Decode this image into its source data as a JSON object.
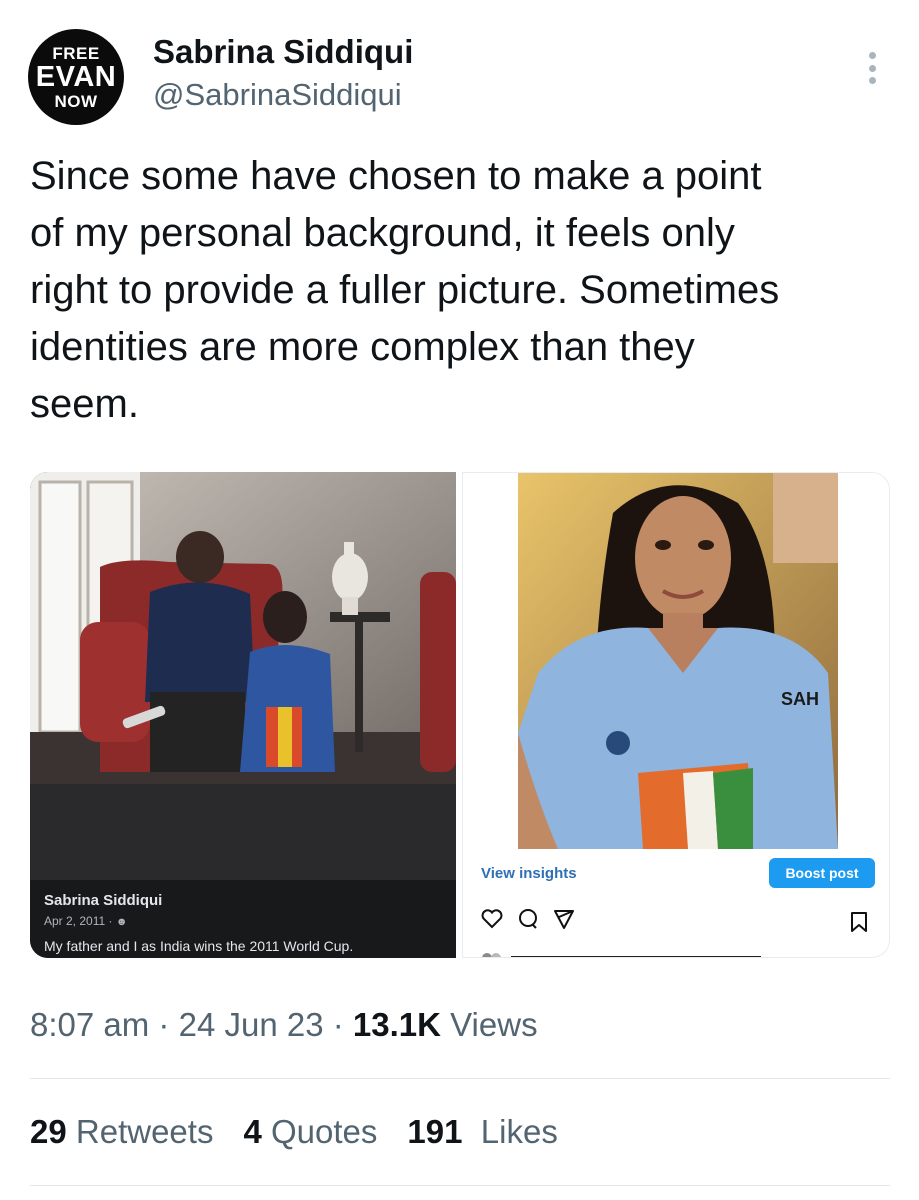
{
  "author": {
    "avatar_lines": [
      "FREE",
      "EVAN",
      "NOW"
    ],
    "name": "Sabrina Siddiqui",
    "handle": "@SabrinaSiddiqui"
  },
  "tweet": {
    "text": "Since some have chosen to make a point\nof my personal background, it feels only\nright to provide a fuller picture. Sometimes\nidentities are more complex than they\nseem."
  },
  "media": {
    "left": {
      "author": "Sabrina Siddiqui",
      "date": "Apr 2, 2011 ·",
      "caption": "My father and I as India wins the 2011 World Cup."
    },
    "right": {
      "view_insights": "View insights",
      "boost_label": "Boost post",
      "shirt_text": "SAH"
    }
  },
  "meta": {
    "time": "8:07 am",
    "date": "24 Jun 23",
    "views_count": "13.1K",
    "views_label": "Views"
  },
  "stats": {
    "retweets_count": "29",
    "retweets_label": "Retweets",
    "quotes_count": "4",
    "quotes_label": "Quotes",
    "likes_count": "191",
    "likes_label": "Likes"
  },
  "colors": {
    "secondary_text": "#536471",
    "primary_text": "#0f1419",
    "boost": "#1d9bf0",
    "insights_link": "#2f6fb5"
  }
}
